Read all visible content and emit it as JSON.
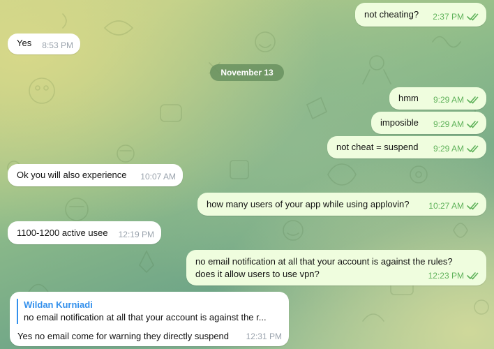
{
  "colors": {
    "incoming_bubble": "#ffffff",
    "outgoing_bubble": "#effdde",
    "outgoing_time": "#5fb25a",
    "incoming_time": "#9aa3ad",
    "reply_accent": "#3390ec"
  },
  "date_separator": "November 13",
  "messages": [
    {
      "text": "not cheating?",
      "time": "2:37 PM",
      "direction": "out",
      "read_icon": "double-check-icon"
    },
    {
      "text": "Yes",
      "time": "8:53 PM",
      "direction": "in"
    },
    {
      "text": "hmm",
      "time": "9:29 AM",
      "direction": "out",
      "read_icon": "double-check-icon"
    },
    {
      "text": "imposible",
      "time": "9:29 AM",
      "direction": "out",
      "read_icon": "double-check-icon"
    },
    {
      "text": "not cheat = suspend",
      "time": "9:29 AM",
      "direction": "out",
      "read_icon": "double-check-icon"
    },
    {
      "text": "Ok you will also experience",
      "time": "10:07 AM",
      "direction": "in"
    },
    {
      "text": "how many users of your app while using applovin?",
      "time": "10:27 AM",
      "direction": "out",
      "read_icon": "double-check-icon"
    },
    {
      "text": "1100-1200 active usee",
      "time": "12:19 PM",
      "direction": "in"
    },
    {
      "text_line1": "no email notification at all that your account is against the rules?",
      "text_line2": "does it allow users to use vpn?",
      "time": "12:23 PM",
      "direction": "out",
      "read_icon": "double-check-icon"
    },
    {
      "reply_to": {
        "name": "Wildan Kurniadi",
        "text": "no email notification at all that your account is against the r..."
      },
      "text": "Yes no email come for warning they directly suspend",
      "time": "12:31 PM",
      "direction": "in"
    }
  ]
}
